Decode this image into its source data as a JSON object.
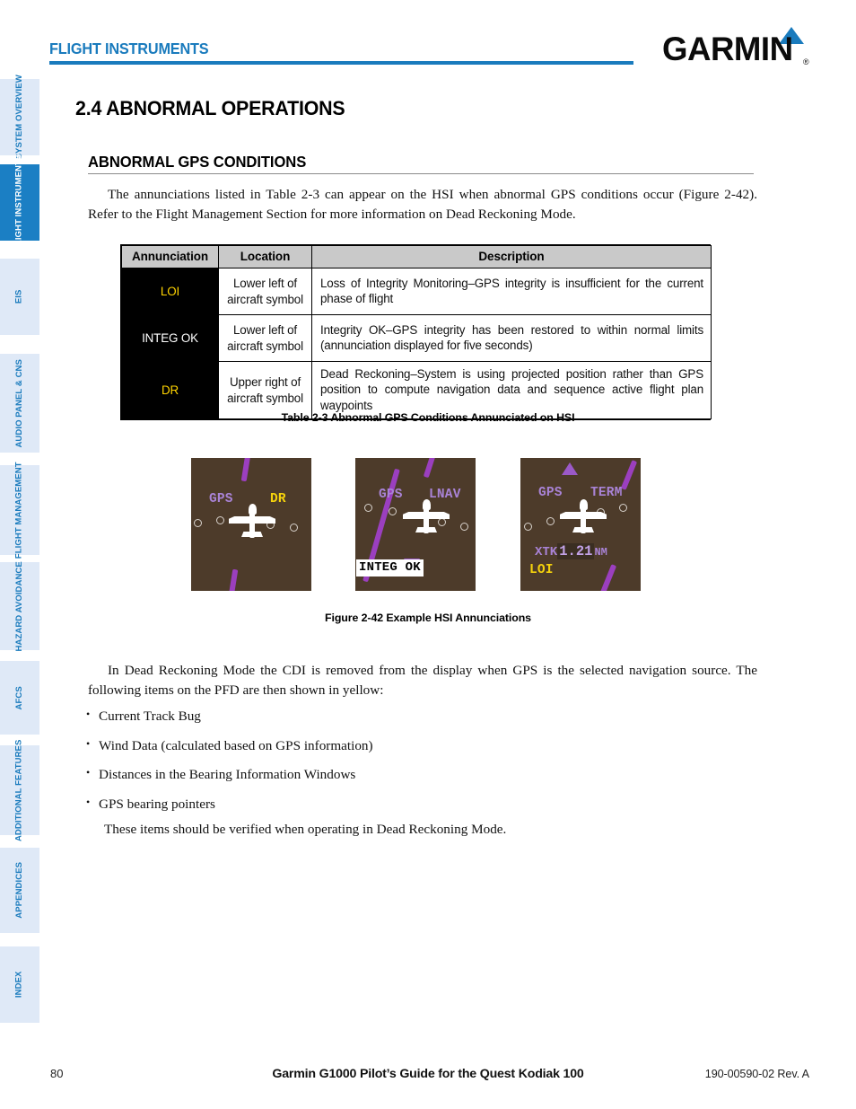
{
  "header": {
    "title": "FLIGHT INSTRUMENTS",
    "brand": "GARMIN",
    "brand_reg": "®",
    "accent_color": "#1a7bbd"
  },
  "sidebar": {
    "items": [
      {
        "label": "SYSTEM OVERVIEW",
        "active": false
      },
      {
        "label": "FLIGHT INSTRUMENTS",
        "active": true
      },
      {
        "label": "EIS",
        "active": false
      },
      {
        "label": "AUDIO PANEL & CNS",
        "active": false
      },
      {
        "label": "FLIGHT MANAGEMENT",
        "active": false
      },
      {
        "label": "HAZARD AVOIDANCE",
        "active": false
      },
      {
        "label": "AFCS",
        "active": false
      },
      {
        "label": "ADDITIONAL FEATURES",
        "active": false
      },
      {
        "label": "APPENDICES",
        "active": false
      },
      {
        "label": "INDEX",
        "active": false
      }
    ]
  },
  "main": {
    "section_title": "2.4  ABNORMAL OPERATIONS",
    "sub_title": "ABNORMAL GPS CONDITIONS",
    "para_1": "The annunciations listed in Table 2-3 can appear on the HSI when abnormal GPS conditions occur (Figure 2-42).  Refer to the Flight Management Section for more information on Dead Reckoning Mode.",
    "para_2": "In Dead Reckoning Mode the CDI is removed from the display when GPS is the selected navigation source. The following items on the PFD are then shown in yellow:",
    "bullets": [
      "Current Track Bug",
      "Wind Data (calculated based on GPS information)",
      "Distances in the Bearing Information Windows",
      "GPS bearing pointers"
    ],
    "para_3": "These items should be verified when operating in Dead Reckoning Mode."
  },
  "table": {
    "caption": "Table 2-3  Abnormal GPS Conditions Annunciated on HSI",
    "headers": [
      "Annunciation",
      "Location",
      "Description"
    ],
    "rows": [
      {
        "annunciation": "LOI",
        "annunciation_color": "#ffd400",
        "location": "Lower left of aircraft symbol",
        "description": "Loss of Integrity Monitoring–GPS integrity is insufficient for the current phase of flight"
      },
      {
        "annunciation": "INTEG OK",
        "annunciation_color": "#ffffff",
        "location": "Lower left of aircraft symbol",
        "description": "Integrity OK–GPS integrity has been restored to within normal limits (annunciation displayed for five seconds)"
      },
      {
        "annunciation": "DR",
        "annunciation_color": "#ffd400",
        "location": "Upper right of aircraft symbol",
        "description": "Dead Reckoning–System is using projected position rather than GPS position to compute navigation data and sequence active flight plan waypoints"
      }
    ]
  },
  "figure": {
    "caption": "Figure 2-42  Example HSI Annunciations",
    "background_color": "#4d3b2a",
    "tiles": [
      {
        "name": "hsi-dr",
        "labels": [
          {
            "text": "GPS",
            "color": "purple"
          },
          {
            "text": "DR",
            "color": "yellow"
          }
        ]
      },
      {
        "name": "hsi-integ-ok",
        "labels": [
          {
            "text": "GPS",
            "color": "purple"
          },
          {
            "text": "LNAV",
            "color": "purple"
          },
          {
            "text": "INTEG OK",
            "color": "black-on-white"
          }
        ]
      },
      {
        "name": "hsi-loi",
        "labels": [
          {
            "text": "GPS",
            "color": "purple"
          },
          {
            "text": "TERM",
            "color": "purple"
          },
          {
            "text": "XTK",
            "color": "purple"
          },
          {
            "text": "1.21",
            "color": "purple-highlight"
          },
          {
            "text": "NM",
            "color": "purple"
          },
          {
            "text": "LOI",
            "color": "yellow"
          }
        ]
      }
    ]
  },
  "footer": {
    "page_number": "80",
    "center_text": "Garmin G1000 Pilot’s Guide for the Quest Kodiak 100",
    "right_text": "190-00590-02  Rev. A"
  }
}
